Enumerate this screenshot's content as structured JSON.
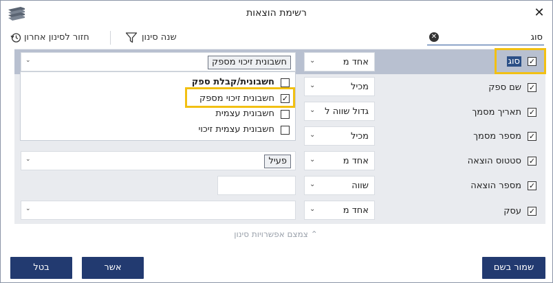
{
  "window": {
    "title": "רשימת הוצאות"
  },
  "toolbar": {
    "reset_label": "חזור לסינון אחרון",
    "change_filter_label": "שנה סינון",
    "search_value": "סוג"
  },
  "rows": [
    {
      "label": "סוג",
      "checked": true,
      "operator": "אחד מ",
      "value_chip": "חשבונית זיכוי מספק"
    },
    {
      "label": "שם ספק",
      "checked": true,
      "operator": "מכיל"
    },
    {
      "label": "תאריך מסמך",
      "checked": true,
      "operator": "גדול שווה ל"
    },
    {
      "label": "מספר מסמך",
      "checked": true,
      "operator": "מכיל"
    },
    {
      "label": "סטטוס הוצאה",
      "checked": true,
      "operator": "אחד מ",
      "value_chip": "פעיל"
    },
    {
      "label": "מספר הוצאה",
      "checked": true,
      "operator": "שווה"
    },
    {
      "label": "עסק",
      "checked": true,
      "operator": "אחד מ"
    }
  ],
  "dropdown_options": [
    {
      "label": "חשבונית/קבלת ספק",
      "checked": false,
      "bold": true
    },
    {
      "label": "חשבונית זיכוי מספק",
      "checked": true,
      "bold": false
    },
    {
      "label": "חשבונית עצמית",
      "checked": false,
      "bold": false
    },
    {
      "label": "חשבונית עצמית זיכוי",
      "checked": false,
      "bold": false
    }
  ],
  "collapse_label": "צמצם אפשרויות סינון",
  "buttons": {
    "cancel": "בטל",
    "confirm": "אשר",
    "save_as": "שמור בשם"
  },
  "colors": {
    "primary": "#223a70",
    "highlight": "#f2c012",
    "selected_band": "#b8c0d0",
    "panel": "#e9ebef"
  }
}
